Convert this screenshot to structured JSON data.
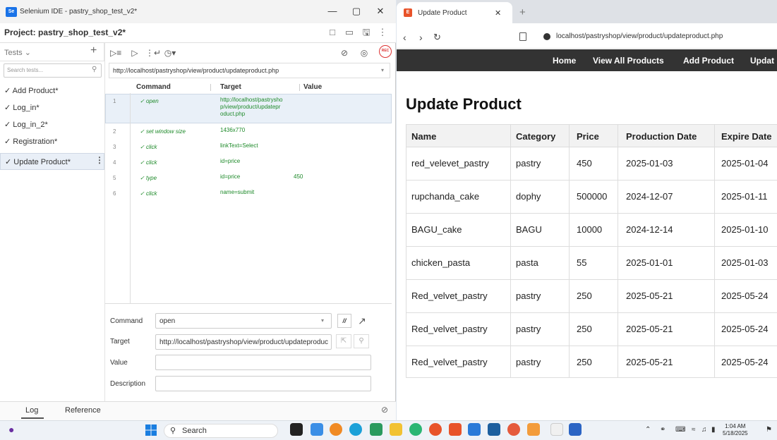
{
  "selenium": {
    "window_title": "Selenium IDE - pastry_shop_test_v2*",
    "logo_text": "Se",
    "project_title": "Project: pastry_shop_test_v2*",
    "tests_dropdown": "Tests",
    "search_placeholder": "Search tests...",
    "tests": [
      "Add Product*",
      "Log_in*",
      "Log_in_2*",
      "Registration*",
      "Update Product*"
    ],
    "selected_test_index": 4,
    "base_url": "http://localhost/pastryshop/view/product/updateproduct.php",
    "columns": {
      "command": "Command",
      "target": "Target",
      "value": "Value"
    },
    "commands": [
      {
        "num": "1",
        "command": "open",
        "target": [
          "http://localhost/pastrysho",
          "p/view/product/updatepr",
          "oduct.php"
        ],
        "value": ""
      },
      {
        "num": "2",
        "command": "set window size",
        "target": [
          "1436x770"
        ],
        "value": ""
      },
      {
        "num": "3",
        "command": "click",
        "target": [
          "linkText=Select"
        ],
        "value": ""
      },
      {
        "num": "4",
        "command": "click",
        "target": [
          "id=price"
        ],
        "value": ""
      },
      {
        "num": "5",
        "command": "type",
        "target": [
          "id=price"
        ],
        "value": "450"
      },
      {
        "num": "6",
        "command": "click",
        "target": [
          "name=submit"
        ],
        "value": ""
      }
    ],
    "editor": {
      "command_label": "Command",
      "command_value": "open",
      "target_label": "Target",
      "target_value": "http://localhost/pastryshop/view/product/updateproduc",
      "value_label": "Value",
      "value_value": "",
      "description_label": "Description",
      "description_value": "",
      "toggle_label": "//"
    },
    "bottom_tabs": {
      "log": "Log",
      "reference": "Reference"
    },
    "rec_label": "REC"
  },
  "browser": {
    "tab_title": "Update Product",
    "favicon_text": "E",
    "address": "localhost/pastryshop/view/product/updateproduct.php",
    "nav_links": [
      "Home",
      "View All Products",
      "Add Product",
      "Updat"
    ],
    "page_title": "Update Product",
    "table": {
      "headers": [
        "Name",
        "Category",
        "Price",
        "Production Date",
        "Expire Date"
      ],
      "rows": [
        [
          "red_velevet_pastry",
          "pastry",
          "450",
          "2025-01-03",
          "2025-01-04"
        ],
        [
          "rupchanda_cake",
          "dophy",
          "500000",
          "2024-12-07",
          "2025-01-11"
        ],
        [
          "BAGU_cake",
          "BAGU",
          "10000",
          "2024-12-14",
          "2025-01-10"
        ],
        [
          "chicken_pasta",
          "pasta",
          "55",
          "2025-01-01",
          "2025-01-03"
        ],
        [
          "Red_velvet_pastry",
          "pastry",
          "250",
          "2025-05-21",
          "2025-05-24"
        ],
        [
          "Red_velvet_pastry",
          "pastry",
          "250",
          "2025-05-21",
          "2025-05-24"
        ],
        [
          "Red_velvet_pastry",
          "pastry",
          "250",
          "2025-05-21",
          "2025-05-24"
        ]
      ]
    }
  },
  "taskbar": {
    "search_text": "Search",
    "time": "1:04 AM",
    "date": "5/18/2025"
  },
  "colors": {
    "command_green": "#1e8a2a",
    "nav_bg": "#333333",
    "selection_bg": "#e9f0f8",
    "rec_red": "#dd3333"
  }
}
